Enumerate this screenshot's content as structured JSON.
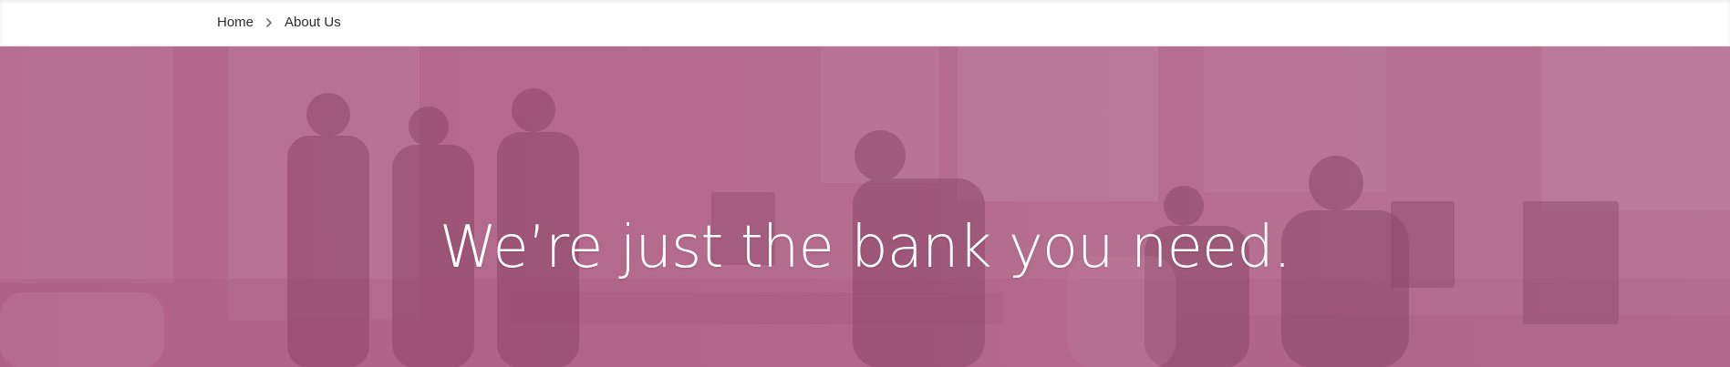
{
  "breadcrumb": {
    "items": [
      {
        "label": "Home"
      },
      {
        "label": "About Us"
      }
    ],
    "separator_icon": "chevron-right-icon"
  },
  "hero": {
    "headline": "We’re just the bank you need.",
    "overlay_color": "#b36d8f"
  }
}
